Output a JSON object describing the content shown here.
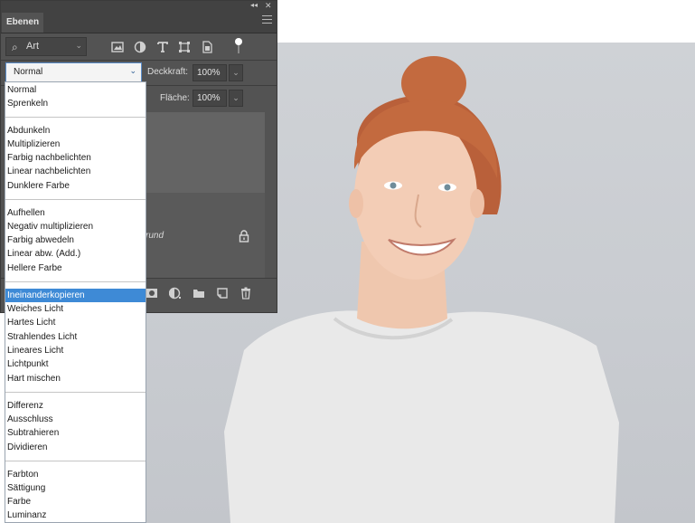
{
  "panel": {
    "tab_label": "Ebenen",
    "filter_label": "Art",
    "blend_mode": "Normal",
    "opacity_label": "Deckkraft:",
    "opacity_value": "100%",
    "fill_label": "Fläche:",
    "fill_value": "100%",
    "layer_name_fragment": "rund",
    "filter_icons": [
      "image-icon",
      "adjustment-icon",
      "text-icon",
      "transform-icon",
      "smart-object-icon",
      "toggle-icon"
    ],
    "bottom_icons": [
      "mask-icon",
      "adjustment-layer-icon",
      "folder-icon",
      "new-layer-icon",
      "trash-icon"
    ]
  },
  "blend_menu": {
    "groups": [
      [
        "Normal",
        "Sprenkeln"
      ],
      [
        "Abdunkeln",
        "Multiplizieren",
        "Farbig nachbelichten",
        "Linear nachbelichten",
        "Dunklere Farbe"
      ],
      [
        "Aufhellen",
        "Negativ multiplizieren",
        "Farbig abwedeln",
        "Linear abw. (Add.)",
        "Hellere Farbe"
      ],
      [
        "Ineinanderkopieren",
        "Weiches Licht",
        "Hartes Licht",
        "Strahlendes Licht",
        "Lineares Licht",
        "Lichtpunkt",
        "Hart mischen"
      ],
      [
        "Differenz",
        "Ausschluss",
        "Subtrahieren",
        "Dividieren"
      ],
      [
        "Farbton",
        "Sättigung",
        "Farbe",
        "Luminanz"
      ]
    ],
    "selected": "Ineinanderkopieren"
  },
  "colors": {
    "panel_bg": "#535353",
    "selection": "#3e8ad6",
    "photo_bg": "#cdd0d5",
    "hair": "#c36a3f"
  }
}
